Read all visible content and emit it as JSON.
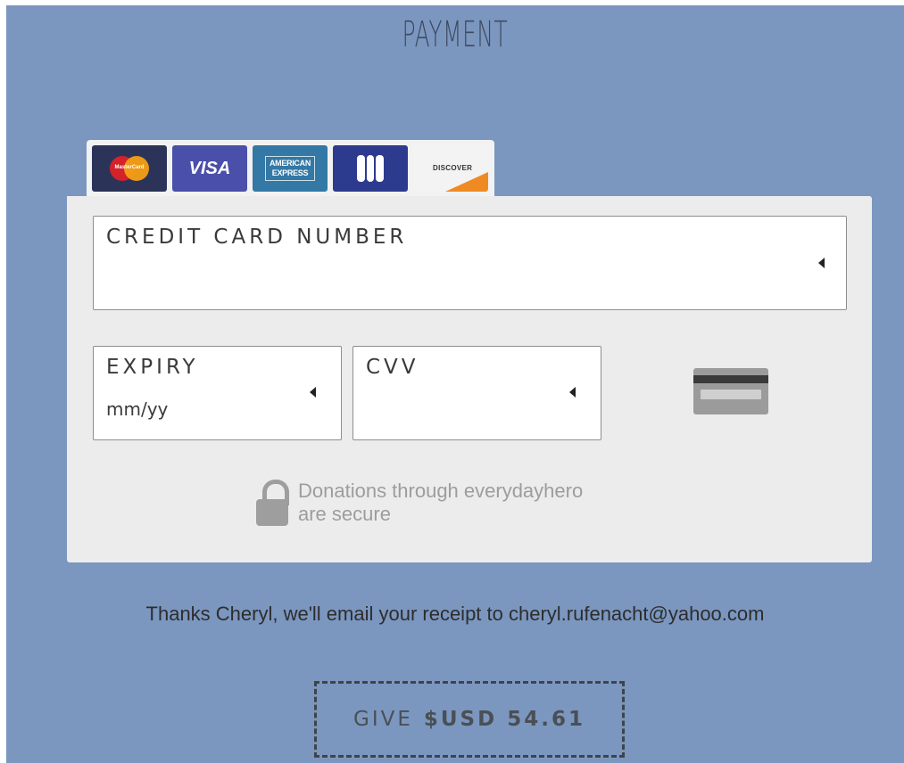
{
  "page": {
    "title": "PAYMENT"
  },
  "card_types": [
    {
      "name": "mastercard",
      "text": "MasterCard",
      "color": "#2b3458"
    },
    {
      "name": "visa",
      "text": "VISA",
      "color": "#4a4fa9"
    },
    {
      "name": "amex",
      "text_line1": "AMERICAN",
      "text_line2": "EXPRESS",
      "color": "#3478a5"
    },
    {
      "name": "jcb",
      "text": "JCB",
      "color": "#2d3b8f"
    },
    {
      "name": "discover",
      "text": "DISCOVER",
      "color": "#f3f3f3"
    }
  ],
  "fields": {
    "card_number": {
      "label": "CREDIT CARD NUMBER",
      "value": ""
    },
    "expiry": {
      "label": "EXPIRY",
      "placeholder": "mm/yy"
    },
    "cvv": {
      "label": "CVV",
      "value": ""
    }
  },
  "secure_notice": {
    "line1": "Donations through everydayhero",
    "line2": "are secure"
  },
  "receipt_message": "Thanks Cheryl, we'll email your receipt to cheryl.rufenacht@yahoo.com",
  "give_button": {
    "prefix": "GIVE",
    "amount": "$USD 54.61"
  },
  "colors": {
    "background": "#7b97c0",
    "form_background": "#ececec"
  }
}
